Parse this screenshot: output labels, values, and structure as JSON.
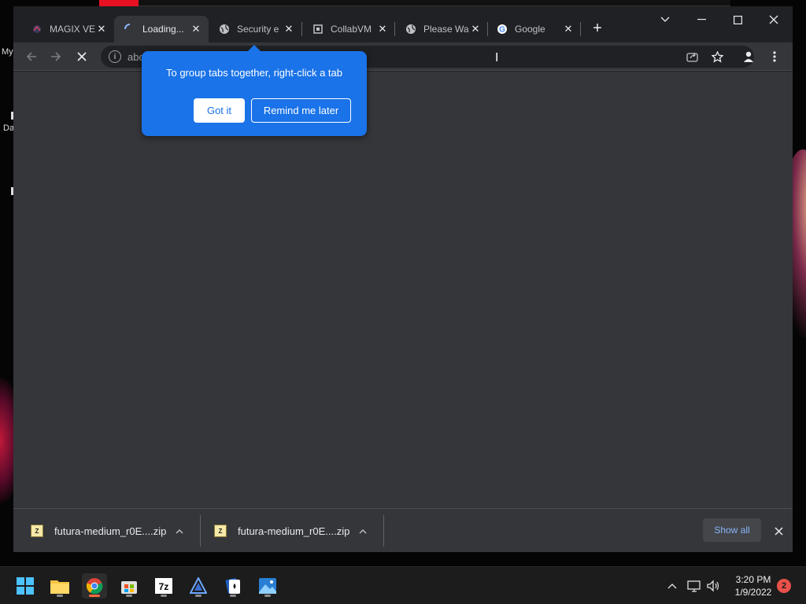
{
  "desktop": {
    "label_my": "My",
    "label_da": "Da"
  },
  "tabs": [
    {
      "label": "MAGIX VE",
      "icon": "magix-icon",
      "active": false
    },
    {
      "label": "Loading...",
      "icon": "loading-spinner-icon",
      "active": true
    },
    {
      "label": "Security e",
      "icon": "globe-icon",
      "active": false
    },
    {
      "label": "CollabVM",
      "icon": "collabvm-icon",
      "active": false
    },
    {
      "label": "Please Wa",
      "icon": "globe-icon",
      "active": false
    },
    {
      "label": "Google",
      "icon": "google-icon",
      "active": false
    }
  ],
  "omnibox": {
    "text": "abo"
  },
  "callout": {
    "message": "To group tabs together, right-click a tab",
    "got_it": "Got it",
    "remind_later": "Remind me later"
  },
  "downloads": {
    "items": [
      {
        "filename": "futura-medium_r0E....zip"
      },
      {
        "filename": "futura-medium_r0E....zip"
      }
    ],
    "show_all": "Show all"
  },
  "taskbar": {
    "time": "3:20 PM",
    "date": "1/9/2022",
    "notification_count": "2"
  },
  "colors": {
    "accent": "#1a73e8",
    "window_bg": "#35363a",
    "titlebar_bg": "#202124",
    "notif_badge": "#e8524a"
  }
}
